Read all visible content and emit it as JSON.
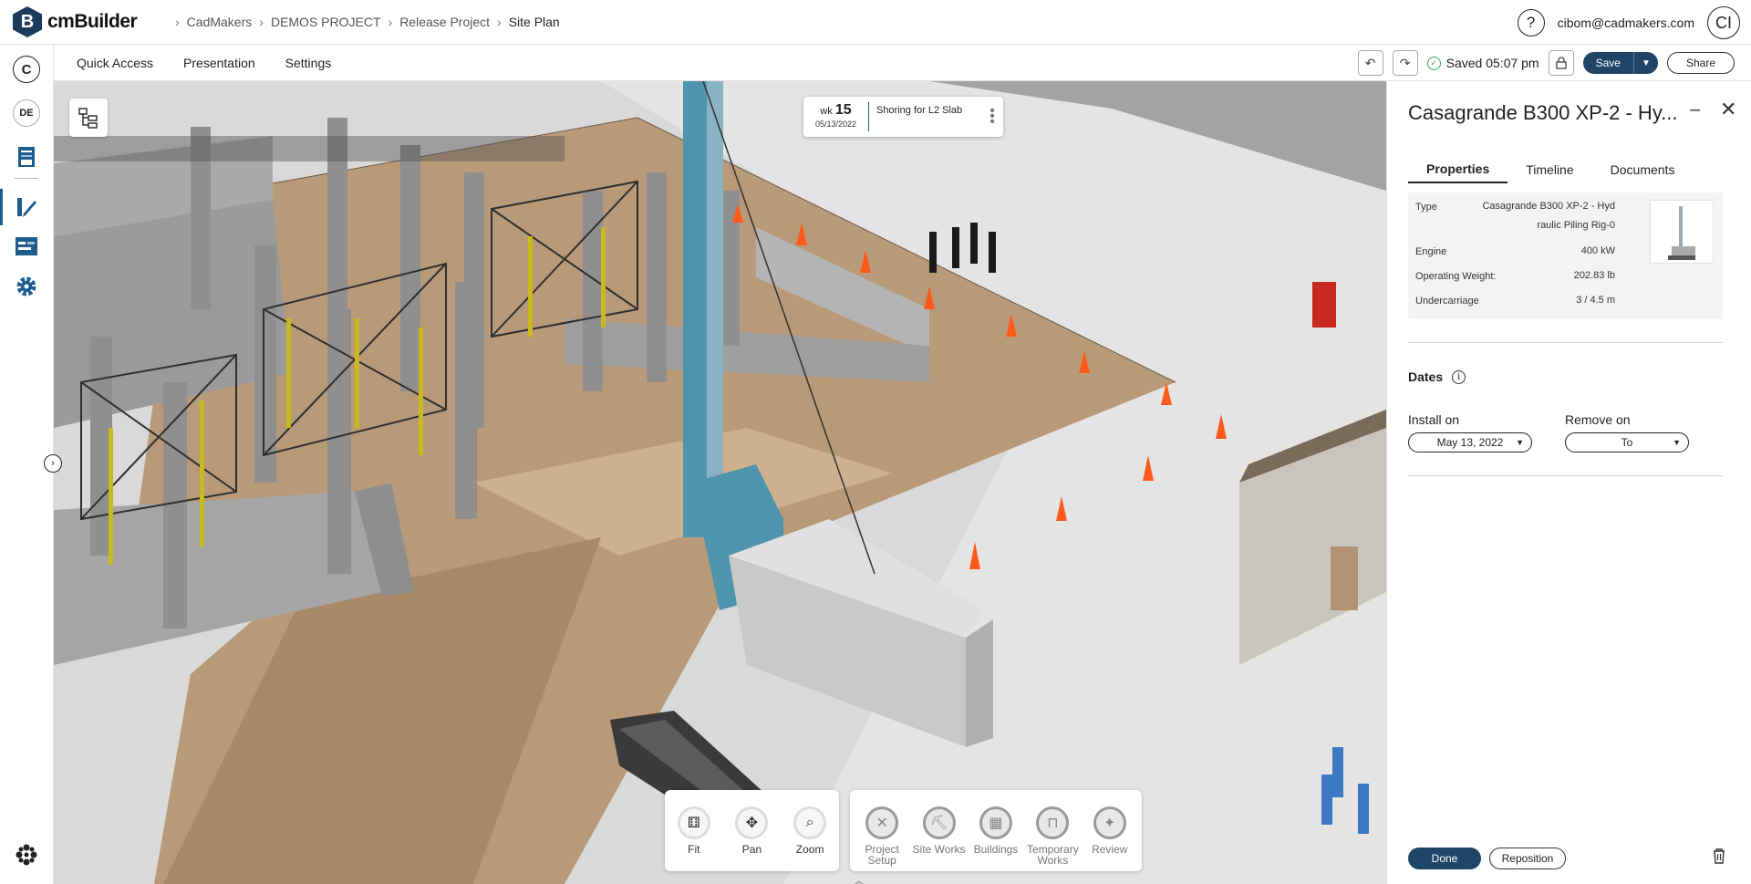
{
  "app": {
    "name": "cmBuilder",
    "logo_letter": "B"
  },
  "breadcrumb": [
    "CadMakers",
    "DEMOS PROJECT",
    "Release Project",
    "Site Plan"
  ],
  "user": {
    "email": "cibom@cadmakers.com",
    "initials": "CI",
    "help": "?"
  },
  "rail": {
    "c_label": "C",
    "de_label": "DE"
  },
  "menus": {
    "quick_access": "Quick Access",
    "presentation": "Presentation",
    "settings": "Settings"
  },
  "status": {
    "saved": "Saved 05:07 pm"
  },
  "buttons": {
    "save": "Save",
    "share": "Share",
    "done": "Done",
    "reposition": "Reposition"
  },
  "timeline_chip": {
    "wk_label": "wk",
    "wk_num": "15",
    "date": "05/13/2022",
    "title": "Shoring for L2 Slab"
  },
  "nav_tools": [
    {
      "label": "Fit",
      "icon": "fit-icon"
    },
    {
      "label": "Pan",
      "icon": "pan-icon"
    },
    {
      "label": "Zoom",
      "icon": "zoom-icon"
    }
  ],
  "categories": [
    {
      "label": "Project Setup",
      "icon": "tools-icon"
    },
    {
      "label": "Site Works",
      "icon": "excavator-icon"
    },
    {
      "label": "Buildings",
      "icon": "building-icon"
    },
    {
      "label": "Temporary Works",
      "icon": "crane-icon"
    },
    {
      "label": "Review",
      "icon": "review-icon"
    }
  ],
  "panel": {
    "title": "Casagrande B300 XP-2 - Hy...",
    "tabs": [
      "Properties",
      "Timeline",
      "Documents"
    ],
    "properties": {
      "type_label": "Type",
      "type_value_line1": "Casagrande B300 XP-2 - Hyd",
      "type_value_line2": "raulic Piling Rig-0",
      "engine_label": "Engine",
      "engine_value": "400 kW",
      "weight_label": "Operating Weight:",
      "weight_value": "202.83 lb",
      "under_label": "Undercarriage",
      "under_value": "3 / 4.5 m"
    },
    "dates": {
      "heading": "Dates",
      "install_label": "Install on",
      "install_value": "May 13, 2022",
      "remove_label": "Remove on",
      "remove_value": "To"
    }
  },
  "colors": {
    "brand": "#1d3c5c",
    "primary_button": "#1e4466",
    "accent": "#1d5c8c",
    "cone": "#ff5a1a",
    "ground": "#b89a78",
    "rig": "#4e95ad"
  }
}
